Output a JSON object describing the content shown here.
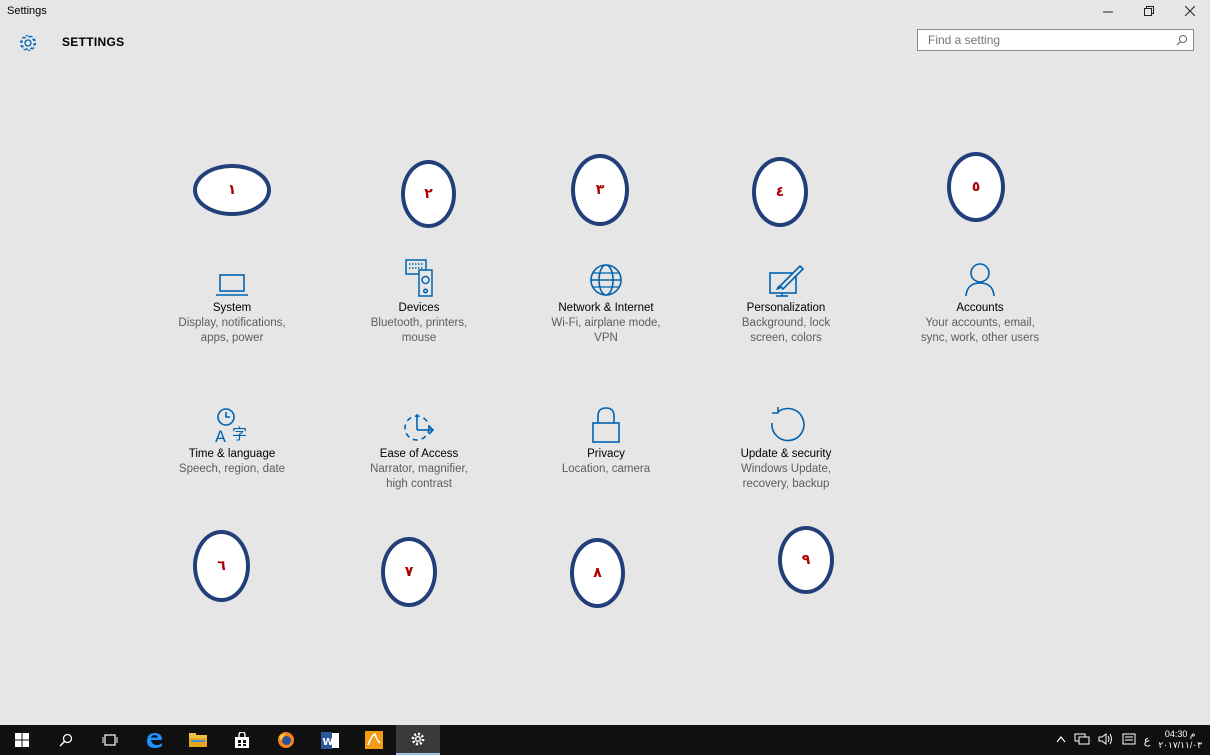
{
  "window": {
    "title": "Settings"
  },
  "header": {
    "heading": "SETTINGS"
  },
  "search": {
    "placeholder": "Find a setting"
  },
  "tiles": [
    {
      "label": "System",
      "desc1": "Display, notifications,",
      "desc2": "apps, power",
      "icon": "laptop-icon"
    },
    {
      "label": "Devices",
      "desc1": "Bluetooth, printers,",
      "desc2": "mouse",
      "icon": "devices-icon"
    },
    {
      "label": "Network & Internet",
      "desc1": "Wi-Fi, airplane mode,",
      "desc2": "VPN",
      "icon": "globe-icon"
    },
    {
      "label": "Personalization",
      "desc1": "Background, lock",
      "desc2": "screen, colors",
      "icon": "paint-brush-icon"
    },
    {
      "label": "Accounts",
      "desc1": "Your accounts, email,",
      "desc2": "sync, work, other users",
      "icon": "person-icon"
    },
    {
      "label": "Time & language",
      "desc1": "Speech, region, date",
      "desc2": "",
      "icon": "time-language-icon"
    },
    {
      "label": "Ease of Access",
      "desc1": "Narrator, magnifier,",
      "desc2": "high contrast",
      "icon": "ease-of-access-icon"
    },
    {
      "label": "Privacy",
      "desc1": "Location, camera",
      "desc2": "",
      "icon": "lock-icon"
    },
    {
      "label": "Update & security",
      "desc1": "Windows Update,",
      "desc2": "recovery, backup",
      "icon": "refresh-icon"
    }
  ],
  "badges": [
    "١",
    "٢",
    "٣",
    "٤",
    "٥",
    "٦",
    "٧",
    "٨",
    "٩"
  ],
  "taskbar": {
    "tray_lang": "ع",
    "time": "04:30 م",
    "date": "٢٠١٧/١١/٠٣"
  },
  "colors": {
    "accent": "#0063b1",
    "badge_border": "#223f7a",
    "badge_number": "#b00000"
  }
}
